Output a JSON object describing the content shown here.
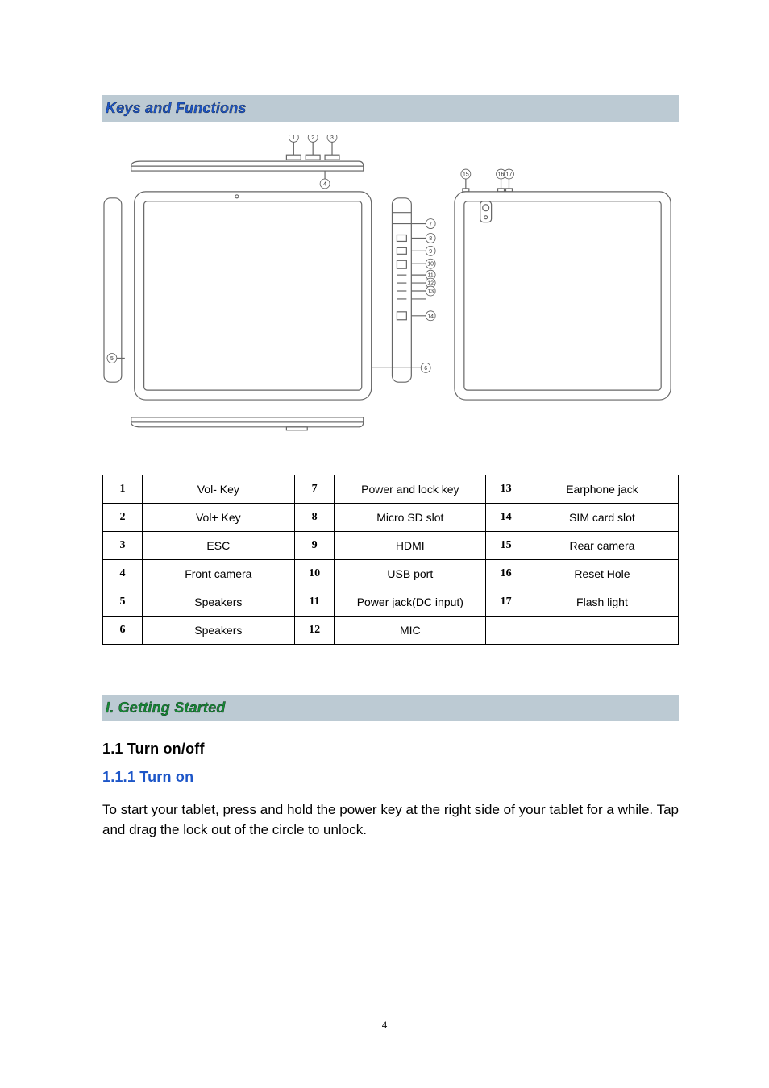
{
  "sections": {
    "keys_functions": "Keys and Functions",
    "getting_started": "I. Getting Started"
  },
  "diagram": {
    "callouts": [
      "1",
      "2",
      "3",
      "4",
      "5",
      "6",
      "7",
      "8",
      "9",
      "10",
      "11",
      "12",
      "13",
      "14",
      "15",
      "16",
      "17"
    ]
  },
  "table": {
    "rows": [
      {
        "n1": "1",
        "f1": "Vol- Key",
        "n2": "7",
        "f2": "Power and lock key",
        "n3": "13",
        "f3": "Earphone jack"
      },
      {
        "n1": "2",
        "f1": "Vol+ Key",
        "n2": "8",
        "f2": "Micro SD slot",
        "n3": "14",
        "f3": "SIM card slot"
      },
      {
        "n1": "3",
        "f1": "ESC",
        "n2": "9",
        "f2": "HDMI",
        "n3": "15",
        "f3": "Rear camera"
      },
      {
        "n1": "4",
        "f1": "Front camera",
        "n2": "10",
        "f2": "USB port",
        "n3": "16",
        "f3": "Reset Hole"
      },
      {
        "n1": "5",
        "f1": "Speakers",
        "n2": "11",
        "f2": "Power jack(DC input)",
        "n3": "17",
        "f3": "Flash light"
      },
      {
        "n1": "6",
        "f1": "Speakers",
        "n2": "12",
        "f2": "MIC",
        "n3": "",
        "f3": ""
      }
    ]
  },
  "headings": {
    "h11": "1.1 Turn on/off",
    "h111": "1.1.1 Turn on"
  },
  "paragraphs": {
    "p1": "To start your tablet, press and hold the power key at the right side of your tablet for a while. Tap and drag the lock out of the circle to unlock."
  },
  "page_number": "4"
}
